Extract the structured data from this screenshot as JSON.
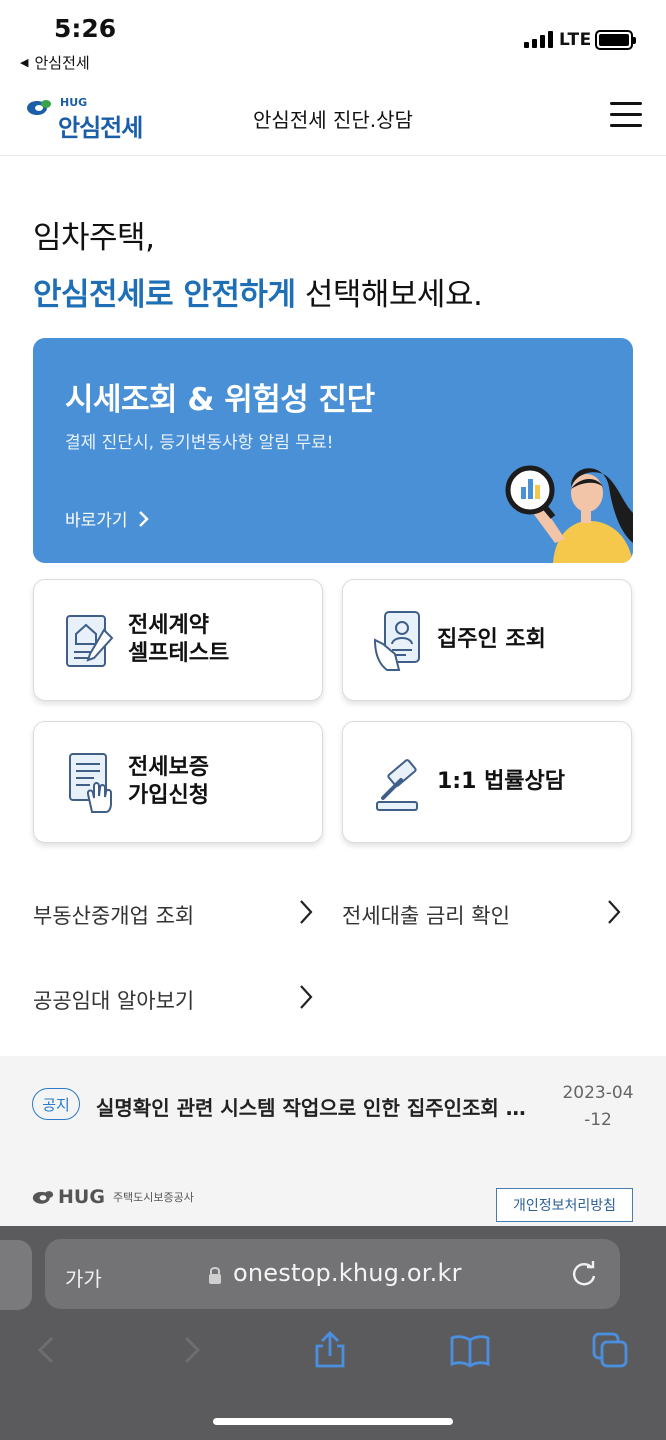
{
  "status": {
    "time": "5:26",
    "back_app": "안심전세",
    "network": "LTE"
  },
  "header": {
    "logo_small": "HUG",
    "logo_name": "안심전세",
    "title": "안심전세 진단.상담"
  },
  "hero": {
    "line1": "임차주택,",
    "line2_accent": "안심전세로 안전하게",
    "line2_rest": " 선택해보세요."
  },
  "banner": {
    "title": "시세조회 & 위험성 진단",
    "subtitle": "결제 진단시, 등기변동사항 알림 무료!",
    "link": "바로가기"
  },
  "cards": [
    {
      "line1": "전세계약",
      "line2": "셀프테스트",
      "icon": "contract-house-icon"
    },
    {
      "line1": "집주인 조회",
      "line2": "",
      "icon": "id-card-hand-icon"
    },
    {
      "line1": "전세보증",
      "line2": "가입신청",
      "icon": "document-hand-icon"
    },
    {
      "line1": "1:1 법률상담",
      "line2": "",
      "icon": "gavel-icon"
    }
  ],
  "links": [
    {
      "label": "부동산중개업 조회"
    },
    {
      "label": "전세대출 금리 확인"
    },
    {
      "label": "공공임대 알아보기"
    }
  ],
  "notice": {
    "badge": "공지",
    "text": "실명확인 관련 시스템 작업으로 인한 집주인조회 …",
    "date_line1": "2023-04",
    "date_line2": "-12"
  },
  "footer": {
    "logo": "HUG",
    "company": "주택도시보증공사",
    "privacy": "개인정보처리방침"
  },
  "browser": {
    "text_size": "가가",
    "url": "onestop.khug.or.kr"
  },
  "colors": {
    "accent": "#1e6fb6",
    "banner": "#4a90d6",
    "chrome": "#5b5b5d",
    "toolbar_icon": "#4a8fe0"
  }
}
